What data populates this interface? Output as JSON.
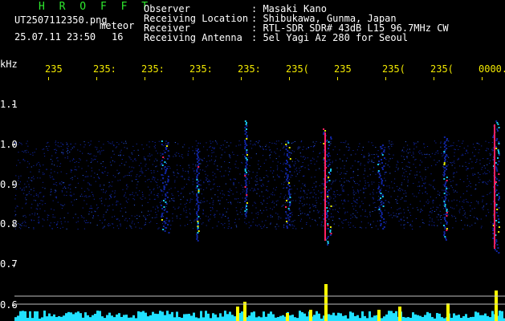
{
  "header": {
    "brand": "H R O F F T",
    "file": "UT2507112350.png",
    "meteor_label": "meteor",
    "datetime": "25.07.11 23:50",
    "count": "16",
    "observer_label": "Observer",
    "observer_value": ": Masaki Kano",
    "location_label": "Receiving Location",
    "location_value": ": Shibukawa, Gunma, Japan",
    "receiver_label": "Receiver",
    "receiver_value": ": RTL-SDR SDR# 43dB L15 96.7MHz CW",
    "antenna_label": "Receiving Antenna",
    "antenna_value": ": 5el Yagi Az 280 for Seoul"
  },
  "spectrogram": {
    "y_unit": "kHz",
    "y_ticks": [
      "1.1",
      "1.0",
      "0.9",
      "0.8",
      "0.7",
      "0.6"
    ],
    "time_ticks": [
      "235",
      "235:",
      "235:",
      "235:",
      "235:",
      "235(",
      "235",
      "235(",
      "235(",
      "0000."
    ],
    "colors": {
      "background": "#000000",
      "text_white": "#ffffff",
      "text_yellow": "#f2e900",
      "brand_green": "#2ee82e",
      "signal_low": "#1024a0",
      "signal_mid": "#18c8f0",
      "signal_high": "#e8f000",
      "signal_peak": "#ff2060",
      "level_trace": "#20e0ff",
      "level_peak": "#ffff00"
    }
  }
}
